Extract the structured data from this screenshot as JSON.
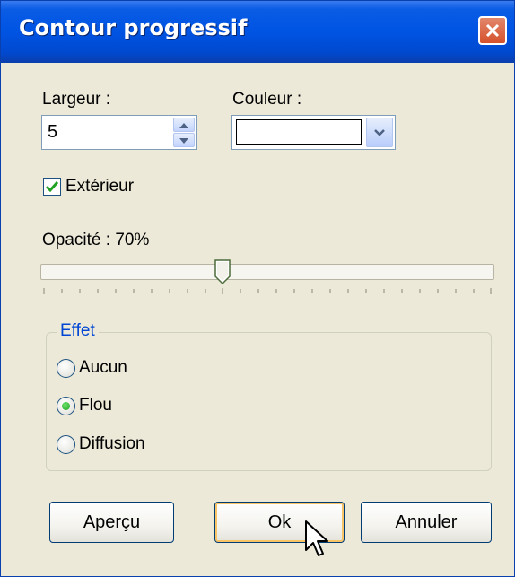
{
  "window": {
    "title": "Contour progressif",
    "close_icon": "close-icon"
  },
  "width_field": {
    "label": "Largeur :",
    "value": "5"
  },
  "color_field": {
    "label": "Couleur :",
    "value_color": "#ffffff"
  },
  "exterior_checkbox": {
    "label": "Extérieur",
    "checked": true
  },
  "opacity": {
    "label": "Opacité : 70%",
    "percent": 70,
    "slider_position_fraction": 0.4
  },
  "effect_group": {
    "label": "Effet",
    "options": [
      {
        "label": "Aucun",
        "selected": false
      },
      {
        "label": "Flou",
        "selected": true
      },
      {
        "label": "Diffusion",
        "selected": false
      }
    ]
  },
  "buttons": {
    "preview": "Aperçu",
    "ok": "Ok",
    "cancel": "Annuler"
  },
  "colors": {
    "title_bar": "#0054e3",
    "dialog_bg": "#ece9d8",
    "group_label": "#0046d5",
    "close_button": "#d5512c",
    "check_mark": "#21a121"
  }
}
